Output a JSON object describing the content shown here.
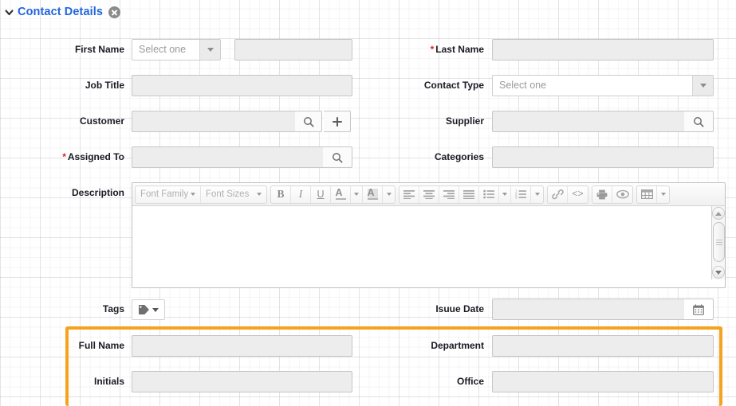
{
  "panel": {
    "title": "Contact Details",
    "collapse_icon": "chevron-down-icon",
    "close_icon": "close-circle-icon"
  },
  "fields": {
    "first_name": {
      "label": "First Name",
      "required": false,
      "select_placeholder": "Select one",
      "text_value": ""
    },
    "last_name": {
      "label": "Last Name",
      "required": true,
      "value": ""
    },
    "job_title": {
      "label": "Job Title",
      "required": false,
      "value": ""
    },
    "contact_type": {
      "label": "Contact Type",
      "required": false,
      "select_placeholder": "Select one"
    },
    "customer": {
      "label": "Customer",
      "required": false,
      "value": "",
      "search_icon": "magnifier-icon",
      "add_icon": "plus-icon"
    },
    "supplier": {
      "label": "Supplier",
      "required": false,
      "value": "",
      "search_icon": "magnifier-icon"
    },
    "assigned_to": {
      "label": "Assigned To",
      "required": true,
      "value": "",
      "search_icon": "magnifier-icon"
    },
    "categories": {
      "label": "Categories",
      "required": false,
      "value": ""
    },
    "description": {
      "label": "Description",
      "required": false,
      "value": ""
    },
    "tags": {
      "label": "Tags",
      "required": false,
      "icon": "tag-icon",
      "caret": "caret-down-icon"
    },
    "issue_date": {
      "label": "Isuue Date",
      "required": false,
      "value": "",
      "calendar_icon": "calendar-icon"
    },
    "full_name": {
      "label": "Full Name",
      "required": false,
      "value": ""
    },
    "department": {
      "label": "Department",
      "required": false,
      "value": ""
    },
    "initials": {
      "label": "Initials",
      "required": false,
      "value": ""
    },
    "office": {
      "label": "Office",
      "required": false,
      "value": ""
    }
  },
  "editor_toolbar": {
    "font_family": {
      "label": "Font Family",
      "icon": "caret-down-icon"
    },
    "font_sizes": {
      "label": "Font Sizes",
      "icon": "caret-down-icon"
    },
    "bold": {
      "label": "B",
      "icon": "bold-icon"
    },
    "italic": {
      "label": "I",
      "icon": "italic-icon"
    },
    "underline": {
      "label": "U",
      "icon": "underline-icon"
    },
    "text_color": {
      "label": "A",
      "icon": "text-color-icon"
    },
    "background_color": {
      "label": "A",
      "icon": "background-color-icon"
    },
    "align_left": {
      "icon": "align-left-icon"
    },
    "align_center": {
      "icon": "align-center-icon"
    },
    "align_right": {
      "icon": "align-right-icon"
    },
    "align_justify": {
      "icon": "align-justify-icon"
    },
    "bullet_list": {
      "icon": "bullet-list-icon"
    },
    "numbered_list": {
      "icon": "numbered-list-icon"
    },
    "link": {
      "icon": "link-icon"
    },
    "source_code": {
      "label": "<>",
      "icon": "source-code-icon"
    },
    "print": {
      "icon": "print-icon"
    },
    "preview": {
      "icon": "eye-icon"
    },
    "table": {
      "icon": "table-icon"
    }
  },
  "scrollbar": {
    "up_icon": "scroll-up-arrow-icon",
    "down_icon": "scroll-down-arrow-icon",
    "thumb": "scroll-thumb"
  },
  "colors": {
    "title_blue": "#2266dd",
    "required_red": "#e02020",
    "highlight_orange": "#f5a21e",
    "input_fill": "#ededed",
    "input_border": "#c6c6c6"
  }
}
